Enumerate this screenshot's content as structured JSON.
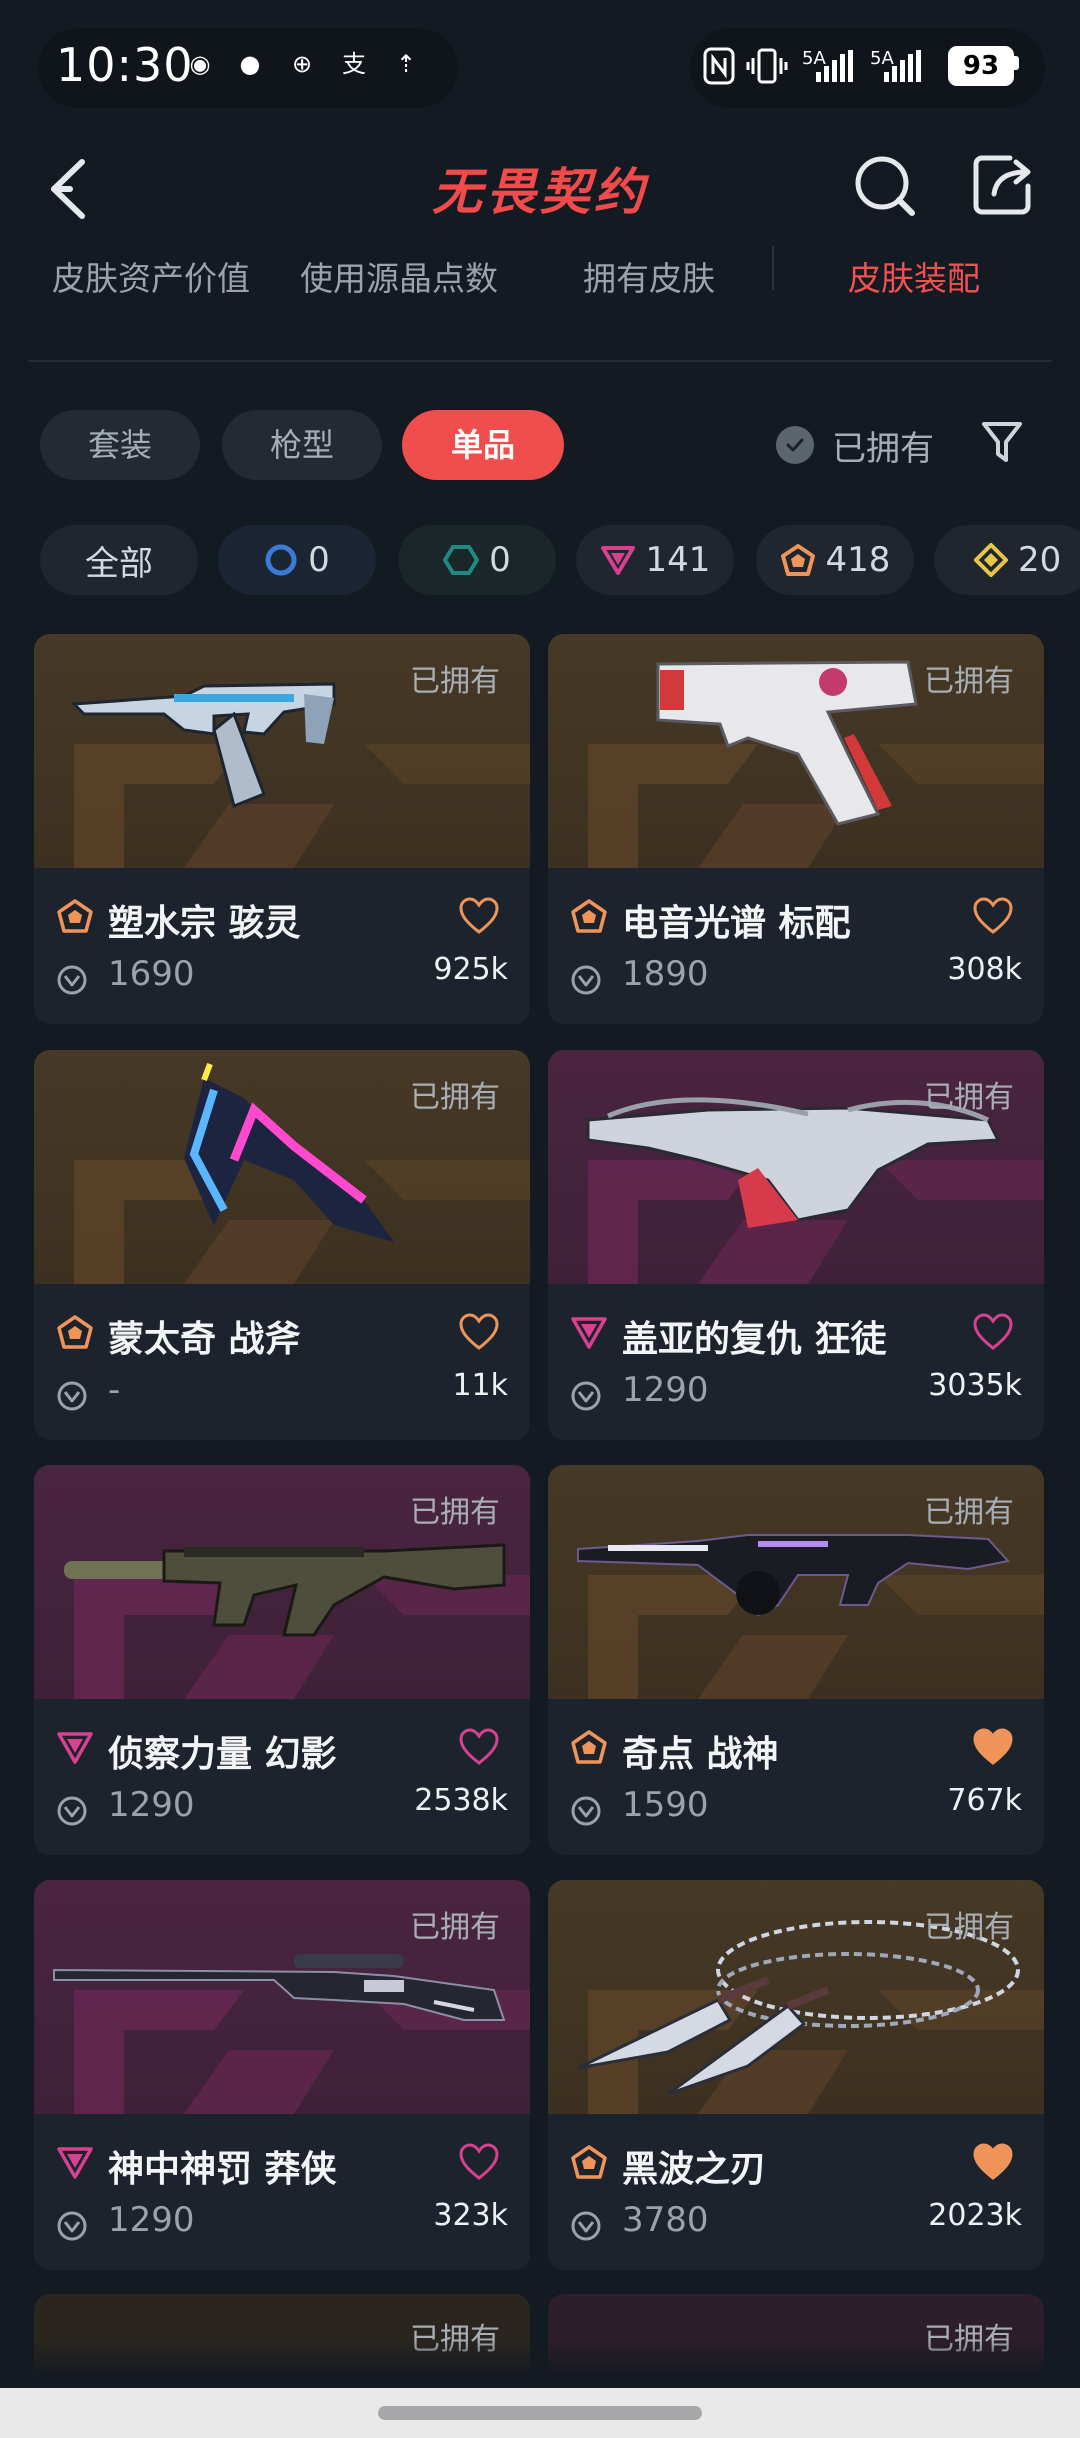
{
  "status_bar": {
    "time": "10:30",
    "apps": [
      {
        "icon": "wechat-icon",
        "color": "#1fb43a",
        "glyph": "◉"
      },
      {
        "icon": "messages-icon",
        "color": "#3b8cf0",
        "glyph": "●"
      },
      {
        "icon": "bank-icon",
        "color": "#c8242b",
        "glyph": "⊕"
      },
      {
        "icon": "alipay-icon",
        "color": "#1677ff",
        "glyph": "支"
      },
      {
        "icon": "upload-icon",
        "color": "#2f7ef5",
        "glyph": "⇡"
      }
    ],
    "net1": "5A",
    "net2": "5A",
    "battery": "93"
  },
  "header": {
    "title": "无畏契约",
    "back_icon": "back-arrow-icon",
    "search_icon": "search-icon",
    "share_icon": "share-icon"
  },
  "tabs": [
    {
      "label": "皮肤资产价值",
      "active": false
    },
    {
      "label": "使用源晶点数",
      "active": false
    },
    {
      "label": "拥有皮肤",
      "active": false
    },
    {
      "label": "皮肤装配",
      "active": true
    }
  ],
  "filters": {
    "chips": [
      {
        "label": "套装",
        "active": false
      },
      {
        "label": "枪型",
        "active": false
      },
      {
        "label": "单品",
        "active": true
      }
    ],
    "owned_label": "已拥有",
    "filter_icon": "funnel-icon"
  },
  "tiers": [
    {
      "label": "全部",
      "icon": null,
      "count": ""
    },
    {
      "label": "",
      "icon": "select-tier-icon",
      "color": "#3a7bd5",
      "count": "0"
    },
    {
      "label": "",
      "icon": "deluxe-tier-icon",
      "color": "#1f8a84",
      "count": "0"
    },
    {
      "label": "",
      "icon": "premium-tier-icon",
      "color": "#d7418f",
      "count": "141"
    },
    {
      "label": "",
      "icon": "exclusive-tier-icon",
      "color": "#f0955a",
      "count": "418"
    },
    {
      "label": "",
      "icon": "ultra-tier-icon",
      "color": "#e8c547",
      "count": "20"
    }
  ],
  "owned_tag": "已拥有",
  "skins": [
    {
      "name": "塑水宗 骇灵",
      "price": "1690",
      "count": "925k",
      "tier": "exclusive",
      "bg": "gold",
      "favorited": false,
      "weapon": "smg"
    },
    {
      "name": "电音光谱 标配",
      "price": "1890",
      "count": "308k",
      "tier": "exclusive",
      "bg": "gold",
      "favorited": false,
      "weapon": "pistol"
    },
    {
      "name": "蒙太奇 战斧",
      "price": "-",
      "count": "11k",
      "tier": "exclusive",
      "bg": "gold",
      "favorited": false,
      "weapon": "axe"
    },
    {
      "name": "盖亚的复仇 狂徒",
      "price": "1290",
      "count": "3035k",
      "tier": "premium",
      "bg": "pink",
      "favorited": false,
      "weapon": "rifle"
    },
    {
      "name": "侦察力量 幻影",
      "price": "1290",
      "count": "2538k",
      "tier": "premium",
      "bg": "pink",
      "favorited": false,
      "weapon": "rifle2"
    },
    {
      "name": "奇点 战神",
      "price": "1590",
      "count": "767k",
      "tier": "exclusive",
      "bg": "gold",
      "favorited": true,
      "weapon": "lmg"
    },
    {
      "name": "神中神罚 莽侠",
      "price": "1290",
      "count": "323k",
      "tier": "premium",
      "bg": "pink",
      "favorited": false,
      "weapon": "sniper"
    },
    {
      "name": "黑波之刃",
      "price": "3780",
      "count": "2023k",
      "tier": "exclusive",
      "bg": "gold",
      "favorited": true,
      "weapon": "kunai"
    }
  ],
  "colors": {
    "accent": "#f04d4d",
    "exclusive": "#f0955a",
    "premium": "#d7418f",
    "background": "#141a22"
  }
}
